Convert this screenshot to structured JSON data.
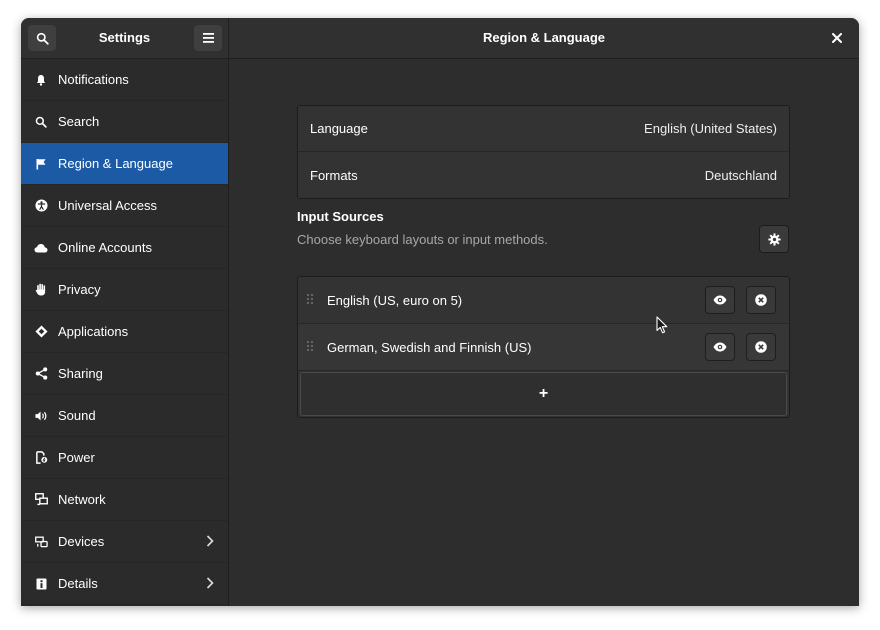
{
  "window": {
    "sidebar_title": "Settings",
    "main_title": "Region & Language",
    "close_glyph": "×"
  },
  "header": {
    "search_icon": "search-icon",
    "menu_icon": "hamburger-menu-icon"
  },
  "sidebar": {
    "items": [
      {
        "label": "Notifications",
        "icon": "bell-icon"
      },
      {
        "label": "Search",
        "icon": "search-icon"
      },
      {
        "label": "Region & Language",
        "icon": "flag-icon",
        "selected": true
      },
      {
        "label": "Universal Access",
        "icon": "accessibility-icon"
      },
      {
        "label": "Online Accounts",
        "icon": "cloud-icon"
      },
      {
        "label": "Privacy",
        "icon": "hand-icon"
      },
      {
        "label": "Applications",
        "icon": "applications-icon"
      },
      {
        "label": "Sharing",
        "icon": "share-icon"
      },
      {
        "label": "Sound",
        "icon": "speaker-icon"
      },
      {
        "label": "Power",
        "icon": "power-icon"
      },
      {
        "label": "Network",
        "icon": "network-icon"
      },
      {
        "label": "Devices",
        "icon": "devices-icon",
        "has_submenu": true
      },
      {
        "label": "Details",
        "icon": "info-icon",
        "has_submenu": true
      }
    ]
  },
  "region": {
    "language_label": "Language",
    "language_value": "English (United States)",
    "formats_label": "Formats",
    "formats_value": "Deutschland"
  },
  "input_sources": {
    "title": "Input Sources",
    "subtitle": "Choose keyboard layouts or input methods.",
    "sources": [
      {
        "label": "English (US, euro on 5)"
      },
      {
        "label": "German, Swedish and Finnish (US)"
      }
    ],
    "add_glyph": "+"
  },
  "colors": {
    "accent": "#1c5aa6",
    "window_bg": "#2d2d2d",
    "header_bg": "#303030"
  }
}
